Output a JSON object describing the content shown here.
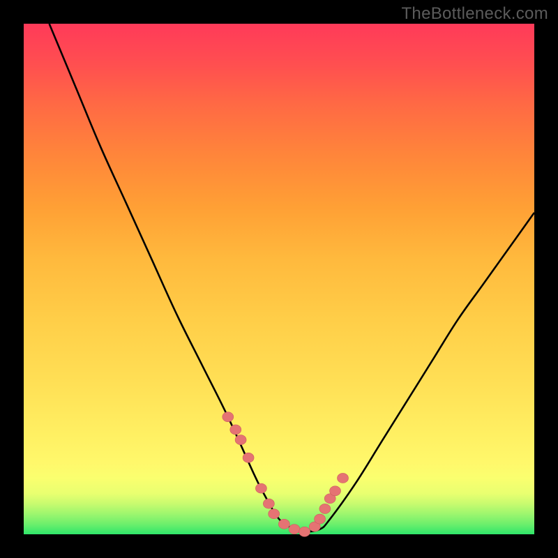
{
  "watermark": "TheBottleneck.com",
  "colors": {
    "frame": "#000000",
    "curve_stroke": "#000000",
    "marker_fill": "#e57373",
    "marker_stroke": "#cc5e5e"
  },
  "chart_data": {
    "type": "line",
    "title": "",
    "xlabel": "",
    "ylabel": "",
    "xlim": [
      0,
      100
    ],
    "ylim": [
      0,
      100
    ],
    "grid": false,
    "legend": false,
    "series": [
      {
        "name": "bottleneck-curve",
        "x": [
          5,
          10,
          15,
          20,
          25,
          30,
          35,
          40,
          45,
          47,
          50,
          53,
          55,
          58,
          60,
          65,
          70,
          75,
          80,
          85,
          90,
          95,
          100
        ],
        "y": [
          100,
          88,
          76,
          65,
          54,
          43,
          33,
          23,
          12,
          8,
          3,
          1,
          0.5,
          1,
          3,
          10,
          18,
          26,
          34,
          42,
          49,
          56,
          63
        ]
      }
    ],
    "markers": {
      "name": "highlight-points",
      "x": [
        40,
        41.5,
        42.5,
        44,
        46.5,
        48,
        49,
        51,
        53,
        55,
        57,
        58,
        59,
        60,
        61,
        62.5
      ],
      "y": [
        23,
        20.5,
        18.5,
        15,
        9,
        6,
        4,
        2,
        1,
        0.5,
        1.5,
        3,
        5,
        7,
        8.5,
        11
      ]
    }
  }
}
